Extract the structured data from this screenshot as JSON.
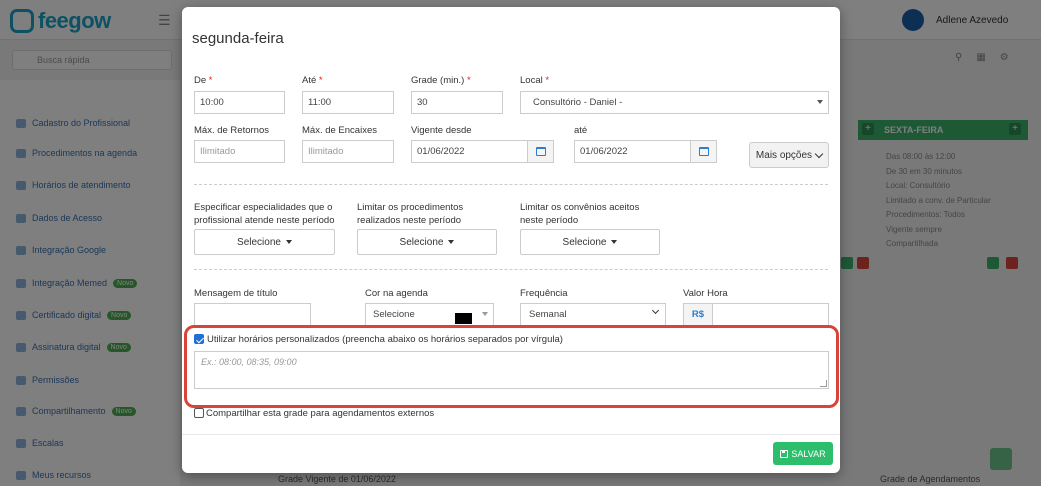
{
  "background": {
    "brand": "feegow",
    "user_name": "Adlene Azevedo",
    "search_placeholder": "Busca rápida",
    "sidebar_items": [
      {
        "label": "Cadastro do Profissional",
        "badge": ""
      },
      {
        "label": "Procedimentos na agenda",
        "badge": ""
      },
      {
        "label": "Horários de atendimento",
        "badge": ""
      },
      {
        "label": "Dados de Acesso",
        "badge": ""
      },
      {
        "label": "Integração Google",
        "badge": ""
      },
      {
        "label": "Integração Memed",
        "badge": "Novo"
      },
      {
        "label": "Certificado digital",
        "badge": "Novo"
      },
      {
        "label": "Assinatura digital",
        "badge": "Novo"
      },
      {
        "label": "Permissões",
        "badge": ""
      },
      {
        "label": "Compartilhamento",
        "badge": "Novo"
      },
      {
        "label": "Escalas",
        "badge": ""
      },
      {
        "label": "Meus recursos",
        "badge": ""
      }
    ],
    "day_column": {
      "title": "SEXTA-FEIRA",
      "lines": [
        "Das 08:00 às 12:00",
        "De 30 em 30 minutos",
        "Local: Consultório",
        "Limitado a conv. de Particular",
        "Procedimentos: Todos",
        "Vigente sempre",
        "Compartilhada"
      ]
    },
    "bottom_text": "Grade  Vigente de  01/06/2022",
    "bottom_right_text": "Grade de Agendamentos"
  },
  "modal": {
    "title": "segunda-feira",
    "row1": {
      "de": {
        "label": "De",
        "value": "10:00"
      },
      "ate": {
        "label": "Até",
        "value": "11:00"
      },
      "grade": {
        "label": "Grade (min.)",
        "value": "30"
      },
      "local": {
        "label": "Local",
        "value": "Consultório - Daniel -"
      }
    },
    "row2": {
      "max_retornos": {
        "label": "Máx. de Retornos",
        "placeholder": "Ilimitado"
      },
      "max_encaixes": {
        "label": "Máx. de Encaixes",
        "placeholder": "Ilimitado"
      },
      "vigente_desde": {
        "label": "Vigente desde",
        "value": "01/06/2022"
      },
      "ate": {
        "label": "até",
        "value": "01/06/2022"
      },
      "mais_opcoes": "Mais opções"
    },
    "row3": {
      "especialidades": {
        "label_line1": "Especificar especialidades que o",
        "label_line2": "profissional atende neste período",
        "button": "Selecione"
      },
      "procedimentos": {
        "label_line1": "Limitar os procedimentos",
        "label_line2": "realizados neste período",
        "button": "Selecione"
      },
      "convenios": {
        "label_line1": "Limitar os convênios aceitos",
        "label_line2": "neste período",
        "button": "Selecione"
      }
    },
    "row4": {
      "mensagem": {
        "label": "Mensagem de título",
        "value": ""
      },
      "cor": {
        "label": "Cor na agenda",
        "value": "Selecione",
        "swatch": "#000000"
      },
      "frequencia": {
        "label": "Frequência",
        "value": "Semanal"
      },
      "valor_hora": {
        "label": "Valor Hora",
        "prefix": "R$",
        "value": ""
      }
    },
    "custom_hours": {
      "checked": true,
      "label": "Utilizar horários personalizados (preencha abaixo os horários separados por vírgula)",
      "placeholder": "Ex.: 08:00, 08:35, 09:00"
    },
    "share": {
      "checked": false,
      "label": "Compartilhar esta grade para agendamentos externos"
    },
    "save_label": "SALVAR"
  },
  "colors": {
    "highlight": "#d9443a",
    "save": "#2dbe6c",
    "required": "#e02020",
    "brand": "#1aa3c9"
  }
}
